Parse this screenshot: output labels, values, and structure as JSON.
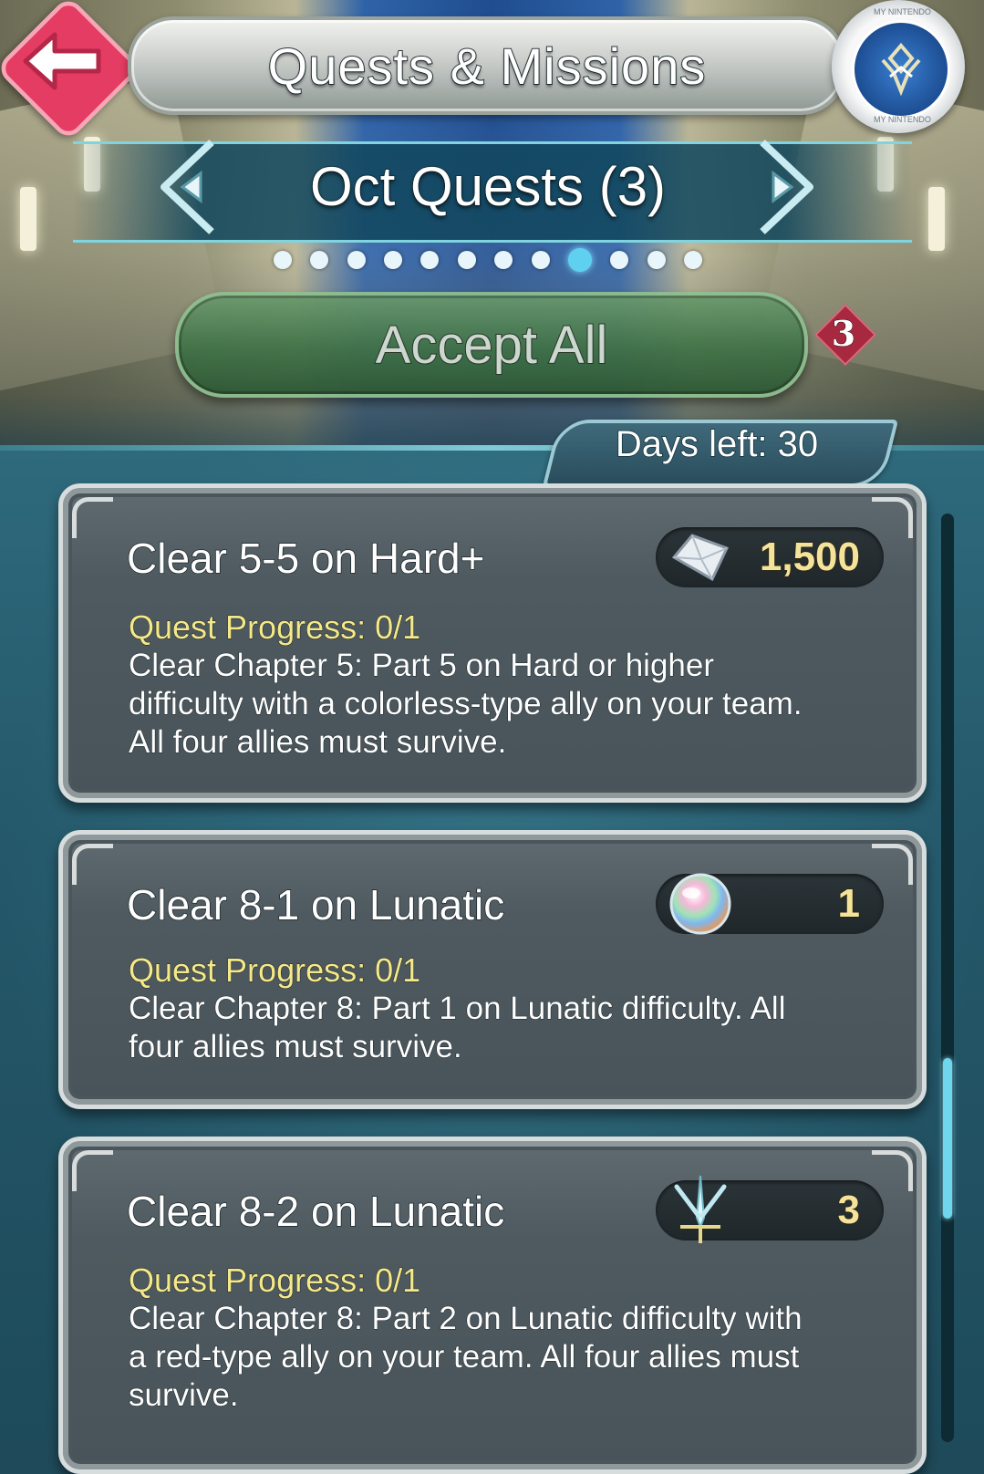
{
  "header": {
    "title": "Quests & Missions",
    "badge_text_top": "MY NINTENDO",
    "badge_text_bottom": "MY NINTENDO"
  },
  "selector": {
    "title": "Oct Quests (3)",
    "page_count": 12,
    "active_page_index": 8
  },
  "accept": {
    "label": "Accept All",
    "count": "3"
  },
  "days_left": "Days left: 30",
  "quests": [
    {
      "title": "Clear 5-5 on Hard+",
      "reward_icon": "feather-crystal-icon",
      "reward_value": "1,500",
      "progress": "Quest Progress: 0/1",
      "description": "Clear Chapter 5: Part 5 on Hard or higher difficulty with a colorless-type ally on your team. All four allies must survive."
    },
    {
      "title": "Clear 8-1 on Lunatic",
      "reward_icon": "orb-icon",
      "reward_value": "1",
      "progress": "Quest Progress: 0/1",
      "description": "Clear Chapter 8: Part 1 on Lunatic difficulty. All four allies must survive."
    },
    {
      "title": "Clear 8-2 on Lunatic",
      "reward_icon": "sword-emblem-icon",
      "reward_value": "3",
      "progress": "Quest Progress: 0/1",
      "description": "Clear Chapter 8: Part 2 on Lunatic difficulty with a red-type ally on your team. All four allies must survive."
    }
  ],
  "colors": {
    "accent": "#5fd0f0",
    "back_button": "#e43c62",
    "progress_text": "#f3e98a",
    "reward_text": "#f4e39a"
  }
}
